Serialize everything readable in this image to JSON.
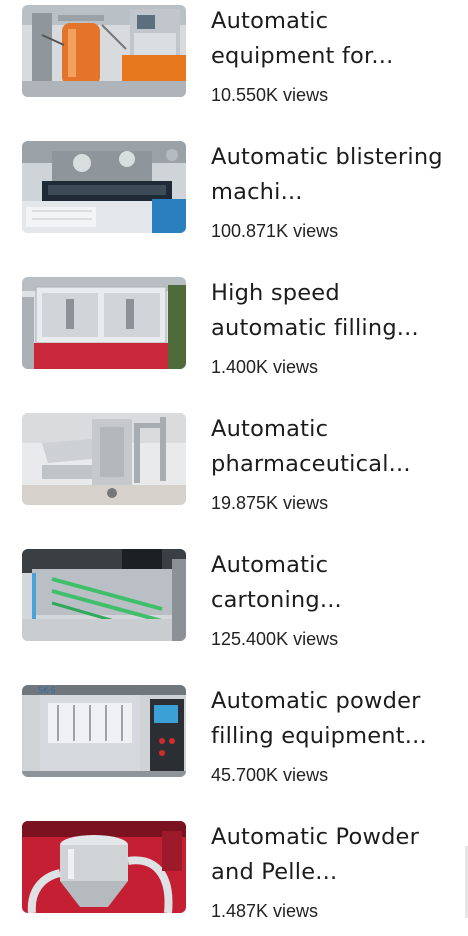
{
  "videos": [
    {
      "title": "Automatic equipment for...",
      "views": "10.550K views",
      "thumbnail": "bioreactor-thumbnail"
    },
    {
      "title": "Automatic blistering machi...",
      "views": "100.871K views",
      "thumbnail": "blister-machine-thumbnail"
    },
    {
      "title": "High speed automatic filling...",
      "views": "1.400K views",
      "thumbnail": "filling-machine-thumbnail"
    },
    {
      "title": "Automatic pharmaceutical...",
      "views": "19.875K views",
      "thumbnail": "pharma-lifter-thumbnail"
    },
    {
      "title": "Automatic cartoning...",
      "views": "125.400K views",
      "thumbnail": "cartoning-machine-thumbnail"
    },
    {
      "title": "Automatic powder filling equipment...",
      "views": "45.700K views",
      "thumbnail": "powder-filler-thumbnail"
    },
    {
      "title": "Automatic Powder and Pelle...",
      "views": "1.487K views",
      "thumbnail": "vacuum-feeder-thumbnail"
    }
  ],
  "thumb_labels": {
    "sk": "SK-6"
  },
  "colors": {
    "text": "#1c1c1c",
    "orange": "#e8781e",
    "red": "#c8283a",
    "steel": "#c9ced3"
  }
}
